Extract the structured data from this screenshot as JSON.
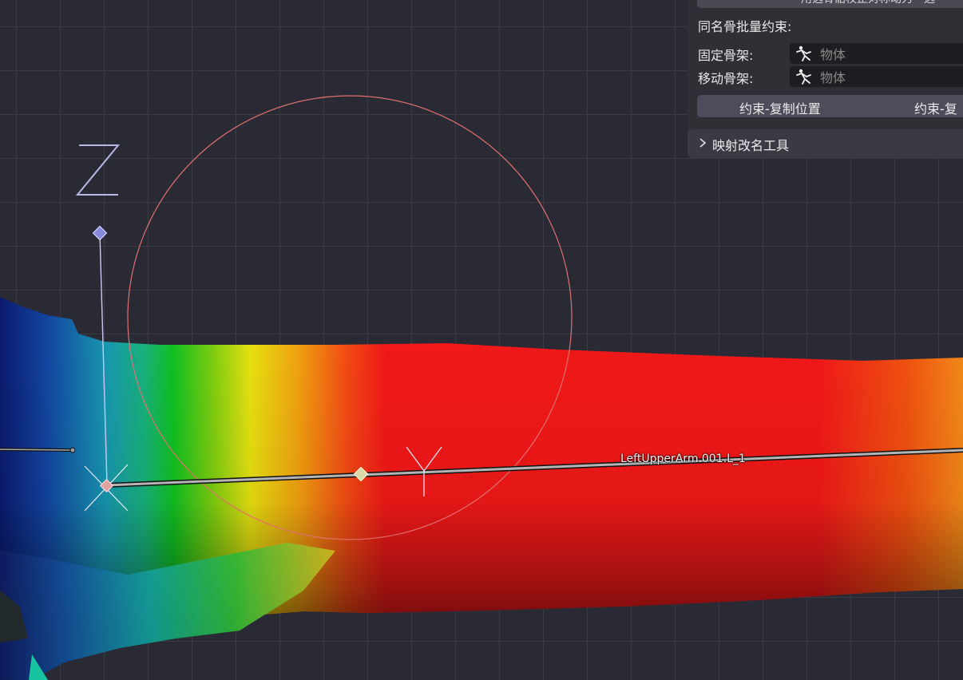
{
  "viewport": {
    "axis_label": "Z",
    "bone_name": "LeftUpperArm.001.L_1"
  },
  "panel": {
    "top_button_label": "用选骨骼校正对称动力 - 选",
    "batch_heading": "同名骨批量约束:",
    "fixed_armature_label": "固定骨架:",
    "moving_armature_label": "移动骨架:",
    "object_placeholder": "物体",
    "copy_location_label": "约束-复制位置",
    "copy_rotation_label": "约束-复",
    "mapping_rename_title": "映射改名工具"
  }
}
